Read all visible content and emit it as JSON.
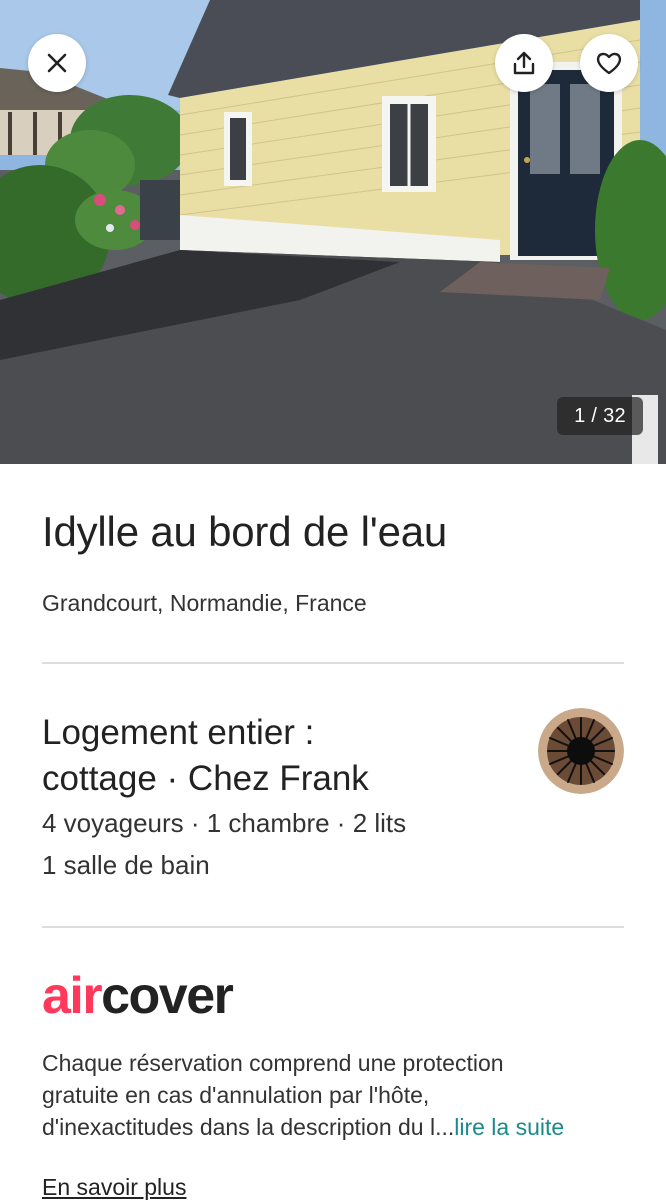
{
  "hero": {
    "photo_counter": "1 / 32",
    "icons": {
      "close": "close-icon",
      "share": "share-icon",
      "favorite": "heart-icon"
    }
  },
  "listing": {
    "title": "Idylle au bord de l'eau",
    "location": "Grandcourt, Normandie, France",
    "type_line1": "Logement entier :",
    "type_line2": "cottage · Chez Frank",
    "capacity": "4 voyageurs · 1 chambre · 2 lits",
    "bathrooms": "1 salle de bain"
  },
  "aircover": {
    "logo_part1": "air",
    "logo_part2": "cover",
    "desc_line1": "Chaque réservation comprend une protection",
    "desc_line2": "gratuite en cas d'annulation par l'hôte,",
    "desc_line3": "d'inexactitudes dans la description du l...",
    "read_more": "lire la suite",
    "learn_more": "En savoir plus"
  },
  "colors": {
    "brand": "#ff385c",
    "link": "#1a8a8a",
    "text": "#222222",
    "divider": "#dddddd"
  }
}
